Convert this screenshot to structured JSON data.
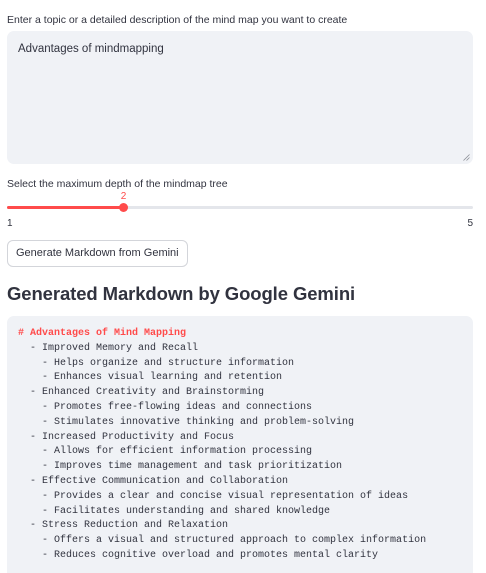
{
  "form": {
    "topic_label": "Enter a topic or a detailed description of the mind map you want to create",
    "topic_value": "Advantages of mindmapping",
    "depth_label": "Select the maximum depth of the mindmap tree",
    "slider": {
      "value": 2,
      "min": 1,
      "max": 5,
      "value_label": "2",
      "min_label": "1",
      "max_label": "5"
    },
    "generate_button": "Generate Markdown from Gemini"
  },
  "result": {
    "heading": "Generated Markdown by Google Gemini",
    "markdown_lines": [
      {
        "text": "# Advantages of Mind Mapping",
        "kind": "heading"
      },
      {
        "text": "  - Improved Memory and Recall",
        "kind": "item"
      },
      {
        "text": "    - Helps organize and structure information",
        "kind": "item"
      },
      {
        "text": "    - Enhances visual learning and retention",
        "kind": "item"
      },
      {
        "text": "  - Enhanced Creativity and Brainstorming",
        "kind": "item"
      },
      {
        "text": "    - Promotes free-flowing ideas and connections",
        "kind": "item"
      },
      {
        "text": "    - Stimulates innovative thinking and problem-solving",
        "kind": "item"
      },
      {
        "text": "  - Increased Productivity and Focus",
        "kind": "item"
      },
      {
        "text": "    - Allows for efficient information processing",
        "kind": "item"
      },
      {
        "text": "    - Improves time management and task prioritization",
        "kind": "item"
      },
      {
        "text": "  - Effective Communication and Collaboration",
        "kind": "item"
      },
      {
        "text": "    - Provides a clear and concise visual representation of ideas",
        "kind": "item"
      },
      {
        "text": "    - Facilitates understanding and shared knowledge",
        "kind": "item"
      },
      {
        "text": "  - Stress Reduction and Relaxation",
        "kind": "item"
      },
      {
        "text": "    - Offers a visual and structured approach to complex information",
        "kind": "item"
      },
      {
        "text": "    - Reduces cognitive overload and promotes mental clarity",
        "kind": "item"
      }
    ]
  },
  "colors": {
    "accent": "#ff4b4b",
    "input_bg": "#f0f2f6",
    "text": "#31333F"
  }
}
